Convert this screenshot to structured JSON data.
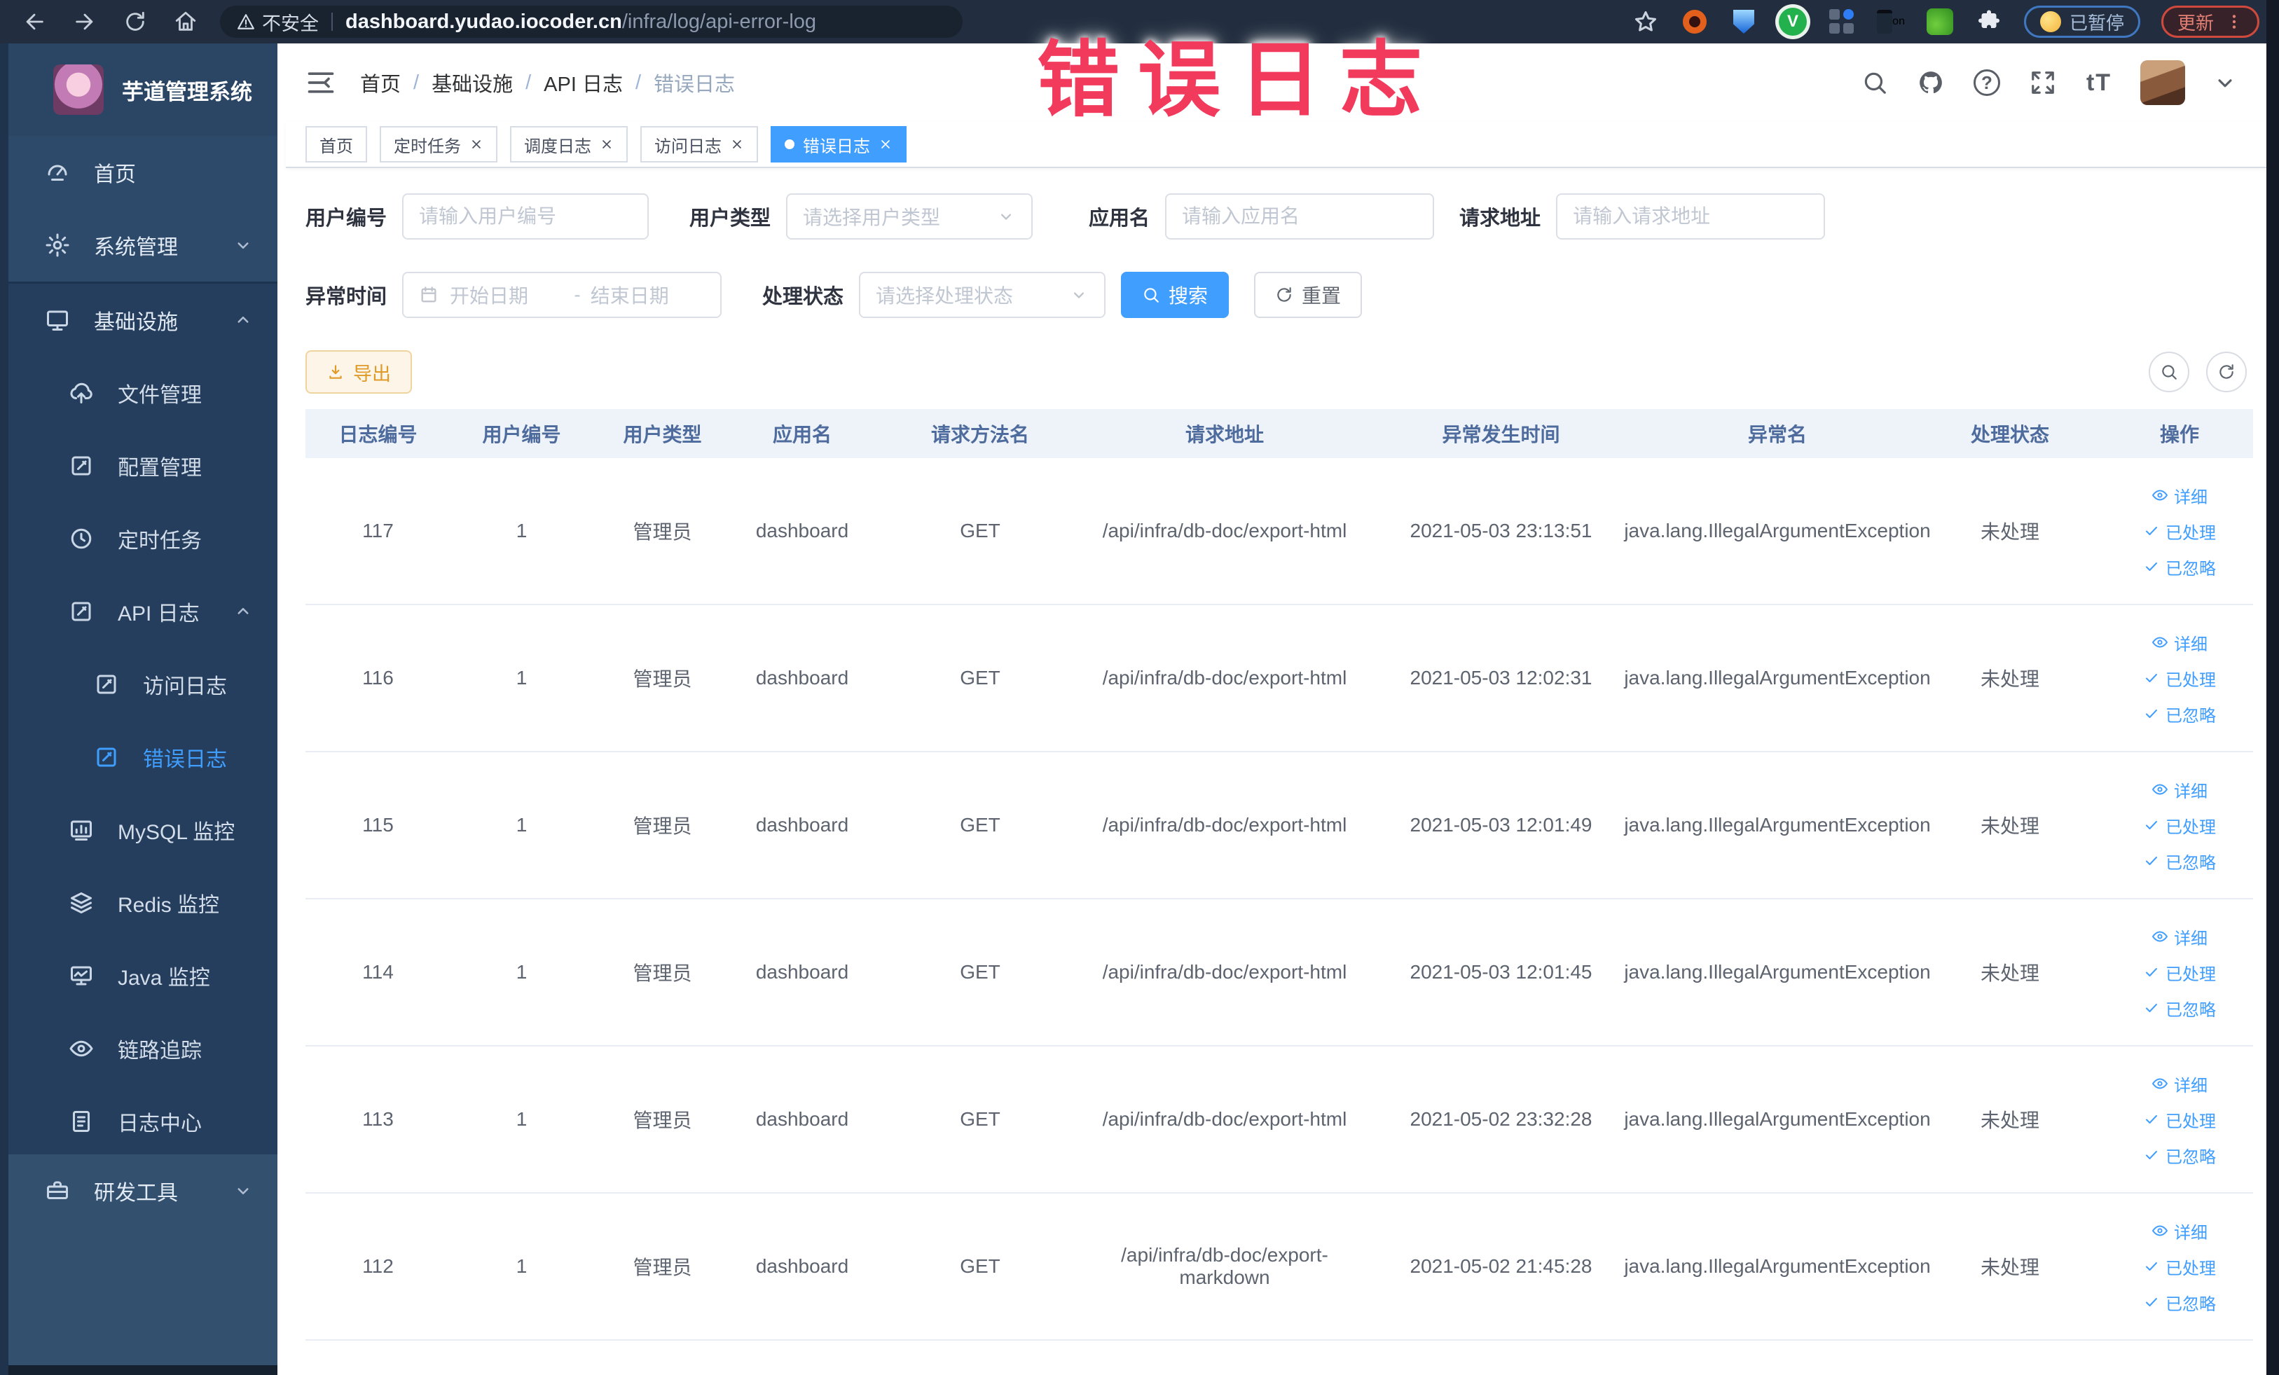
{
  "browser": {
    "security_label": "不安全",
    "url_host": "dashboard.yudao.iocoder.cn",
    "url_path": "/infra/log/api-error-log",
    "ext_badge": "on",
    "paused_chip": "已暂停",
    "update_chip": "更新"
  },
  "annotation": {
    "text": "错误日志",
    "color": "#f23a5c"
  },
  "sidebar": {
    "title": "芋道管理系统",
    "items": [
      {
        "label": "首页"
      },
      {
        "label": "系统管理"
      },
      {
        "label": "基础设施"
      },
      {
        "label": "文件管理"
      },
      {
        "label": "配置管理"
      },
      {
        "label": "定时任务"
      },
      {
        "label": "API 日志"
      },
      {
        "label": "访问日志"
      },
      {
        "label": "错误日志",
        "active": true
      },
      {
        "label": "MySQL 监控"
      },
      {
        "label": "Redis 监控"
      },
      {
        "label": "Java 监控"
      },
      {
        "label": "链路追踪"
      },
      {
        "label": "日志中心"
      },
      {
        "label": "研发工具"
      }
    ]
  },
  "breadcrumb": {
    "items": [
      "首页",
      "基础设施",
      "API 日志"
    ],
    "current": "错误日志",
    "separator": "/"
  },
  "tags": [
    {
      "label": "首页",
      "closable": false,
      "active": false
    },
    {
      "label": "定时任务",
      "closable": true,
      "active": false
    },
    {
      "label": "调度日志",
      "closable": true,
      "active": false
    },
    {
      "label": "访问日志",
      "closable": true,
      "active": false
    },
    {
      "label": "错误日志",
      "closable": true,
      "active": true
    }
  ],
  "filters": {
    "user_no": {
      "label": "用户编号",
      "placeholder": "请输入用户编号"
    },
    "user_type": {
      "label": "用户类型",
      "placeholder": "请选择用户类型"
    },
    "app_name": {
      "label": "应用名",
      "placeholder": "请输入应用名"
    },
    "req_url": {
      "label": "请求地址",
      "placeholder": "请输入请求地址"
    },
    "time": {
      "label": "异常时间",
      "start_placeholder": "开始日期",
      "separator": "-",
      "end_placeholder": "结束日期"
    },
    "status": {
      "label": "处理状态",
      "placeholder": "请选择处理状态"
    },
    "search_label": "搜索",
    "reset_label": "重置"
  },
  "toolbar": {
    "export_label": "导出"
  },
  "table": {
    "columns": [
      "日志编号",
      "用户编号",
      "用户类型",
      "应用名",
      "请求方法名",
      "请求地址",
      "异常发生时间",
      "异常名",
      "处理状态",
      "操作"
    ],
    "actions": {
      "detail": "详细",
      "done": "已处理",
      "ignore": "已忽略"
    },
    "rows": [
      {
        "id": "117",
        "user_id": "1",
        "user_type": "管理员",
        "app": "dashboard",
        "method": "GET",
        "url": "/api/infra/db-doc/export-html",
        "time": "2021-05-03 23:13:51",
        "exception": "java.lang.IllegalArgumentException",
        "status": "未处理"
      },
      {
        "id": "116",
        "user_id": "1",
        "user_type": "管理员",
        "app": "dashboard",
        "method": "GET",
        "url": "/api/infra/db-doc/export-html",
        "time": "2021-05-03 12:02:31",
        "exception": "java.lang.IllegalArgumentException",
        "status": "未处理"
      },
      {
        "id": "115",
        "user_id": "1",
        "user_type": "管理员",
        "app": "dashboard",
        "method": "GET",
        "url": "/api/infra/db-doc/export-html",
        "time": "2021-05-03 12:01:49",
        "exception": "java.lang.IllegalArgumentException",
        "status": "未处理"
      },
      {
        "id": "114",
        "user_id": "1",
        "user_type": "管理员",
        "app": "dashboard",
        "method": "GET",
        "url": "/api/infra/db-doc/export-html",
        "time": "2021-05-03 12:01:45",
        "exception": "java.lang.IllegalArgumentException",
        "status": "未处理"
      },
      {
        "id": "113",
        "user_id": "1",
        "user_type": "管理员",
        "app": "dashboard",
        "method": "GET",
        "url": "/api/infra/db-doc/export-html",
        "time": "2021-05-02 23:32:28",
        "exception": "java.lang.IllegalArgumentException",
        "status": "未处理"
      },
      {
        "id": "112",
        "user_id": "1",
        "user_type": "管理员",
        "app": "dashboard",
        "method": "GET",
        "url": "/api/infra/db-doc/export-markdown",
        "time": "2021-05-02 21:45:28",
        "exception": "java.lang.IllegalArgumentException",
        "status": "未处理"
      }
    ]
  },
  "colors": {
    "accent": "#409eff",
    "warning": "#e09a28",
    "annotation": "#f23a5c",
    "sidebar_bg": "#2e4a6a",
    "table_header_bg": "#eef2f9"
  }
}
